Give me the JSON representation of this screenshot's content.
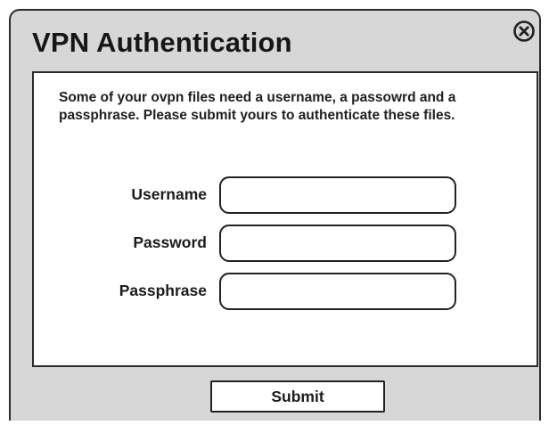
{
  "dialog": {
    "title": "VPN Authentication",
    "close_icon": "close-circle-icon",
    "message": "Some of your ovpn files need a username, a passowrd and a passphrase. Please submit yours to authenticate these files."
  },
  "form": {
    "fields": [
      {
        "label": "Username",
        "value": "",
        "placeholder": ""
      },
      {
        "label": "Password",
        "value": "",
        "placeholder": ""
      },
      {
        "label": "Passphrase",
        "value": "",
        "placeholder": ""
      }
    ],
    "submit_label": "Submit"
  },
  "colors": {
    "dialog_background": "#d7d7d7",
    "panel_background": "#ffffff",
    "border": "#2a2a2a",
    "text": "#1c1c1c"
  }
}
